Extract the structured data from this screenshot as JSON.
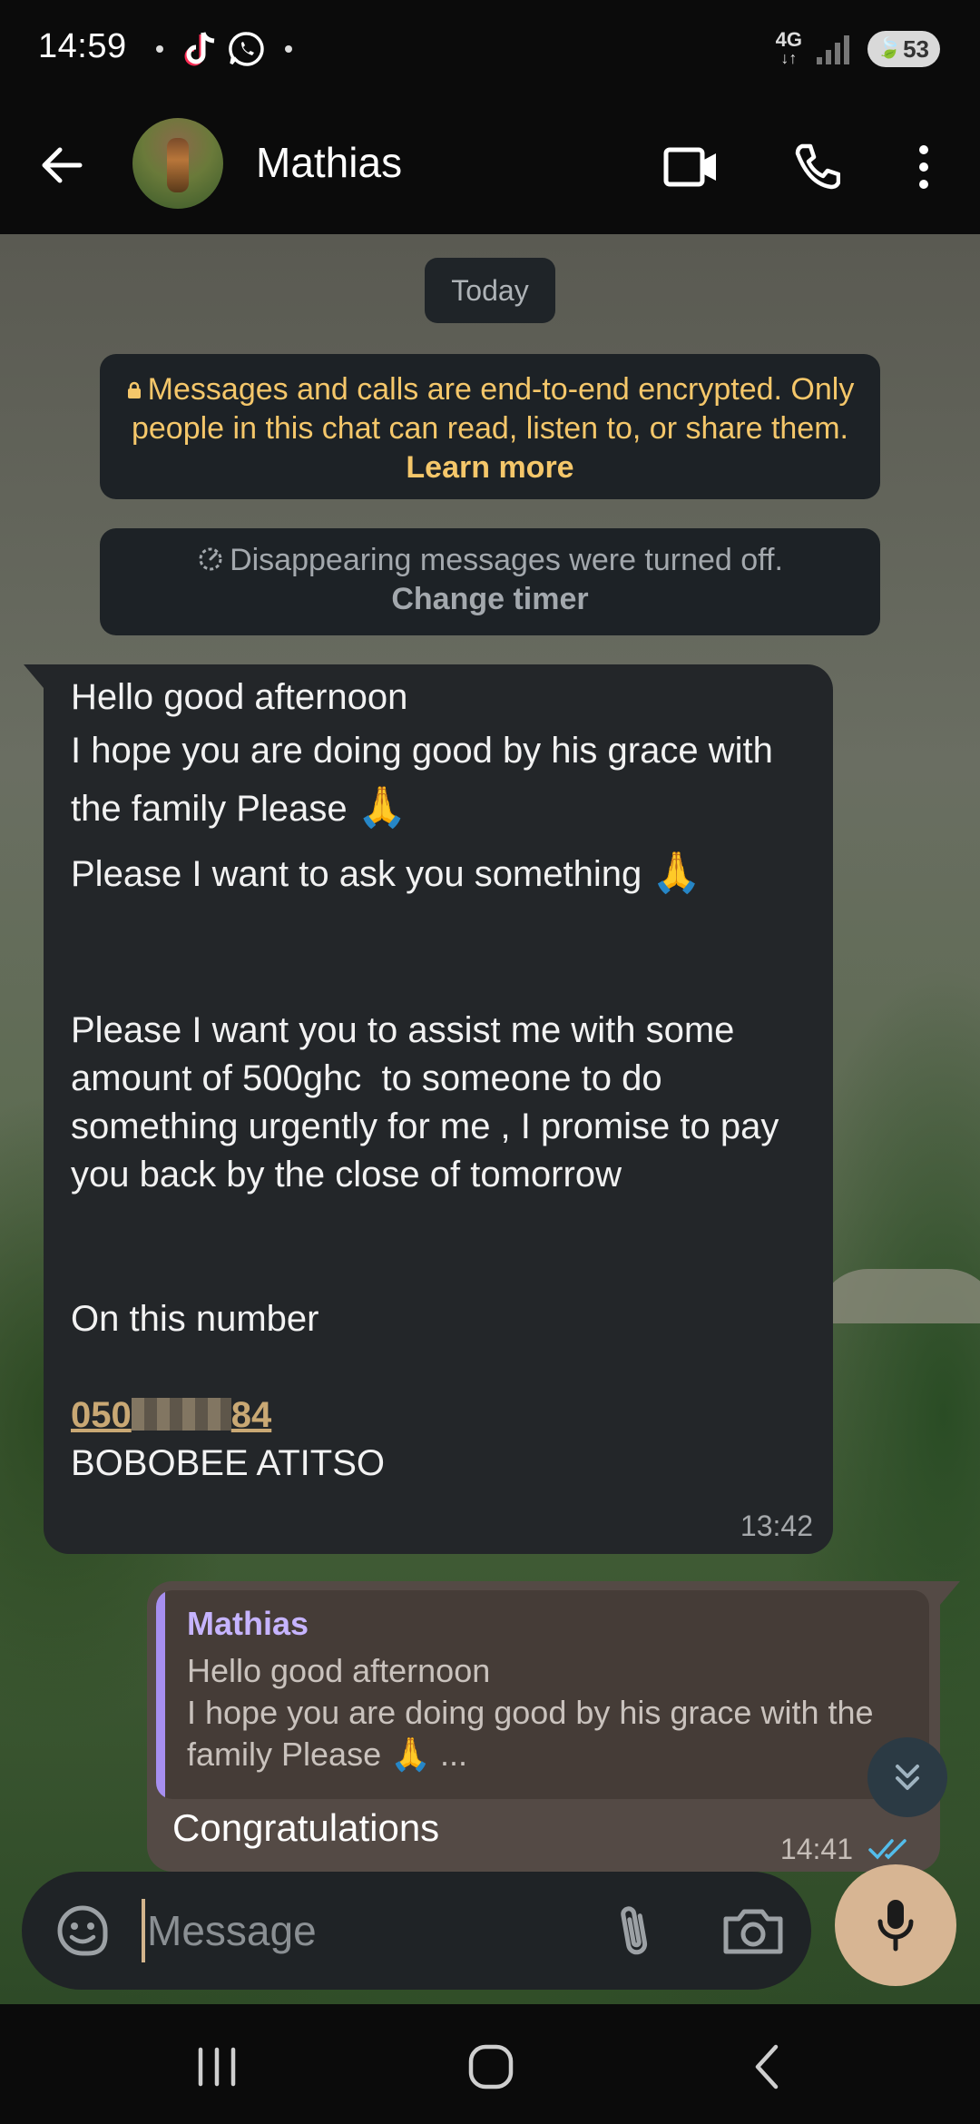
{
  "status_bar": {
    "time": "14:59",
    "network": "4G",
    "battery": "53"
  },
  "header": {
    "contact_name": "Mathias"
  },
  "chat": {
    "date_label": "Today",
    "encryption": {
      "text": "Messages and calls are end-to-end encrypted. Only people in this chat can read, listen to, or share them.",
      "link": "Learn more"
    },
    "disappearing": {
      "text": "Disappearing messages were turned off.",
      "link": "Change timer"
    },
    "incoming": {
      "line1": "Hello good afternoon",
      "line2": "I hope you are doing good by his grace with the family Please",
      "line3": "Please I want to ask you something",
      "line4": "Please I want you to assist me with some amount of 500ghc  to someone to do something urgently for me , I promise to pay you back by the close of tomorrow",
      "line5": "On this number",
      "phone_prefix": "050",
      "phone_suffix": "84",
      "name": "BOBOBEE ATITSO",
      "time": "13:42"
    },
    "outgoing": {
      "quote_name": "Mathias",
      "quote_line1": "Hello good afternoon",
      "quote_line2": "I hope you are doing good by his grace with the family Please",
      "quote_ellipsis": "...",
      "text": "Congratulations",
      "time": "14:41"
    }
  },
  "composer": {
    "placeholder": "Message"
  },
  "colors": {
    "accent": "#d7b593",
    "encryption_text": "#f5c76a",
    "quote_name": "#c6b4ff",
    "tick": "#53bdeb"
  }
}
